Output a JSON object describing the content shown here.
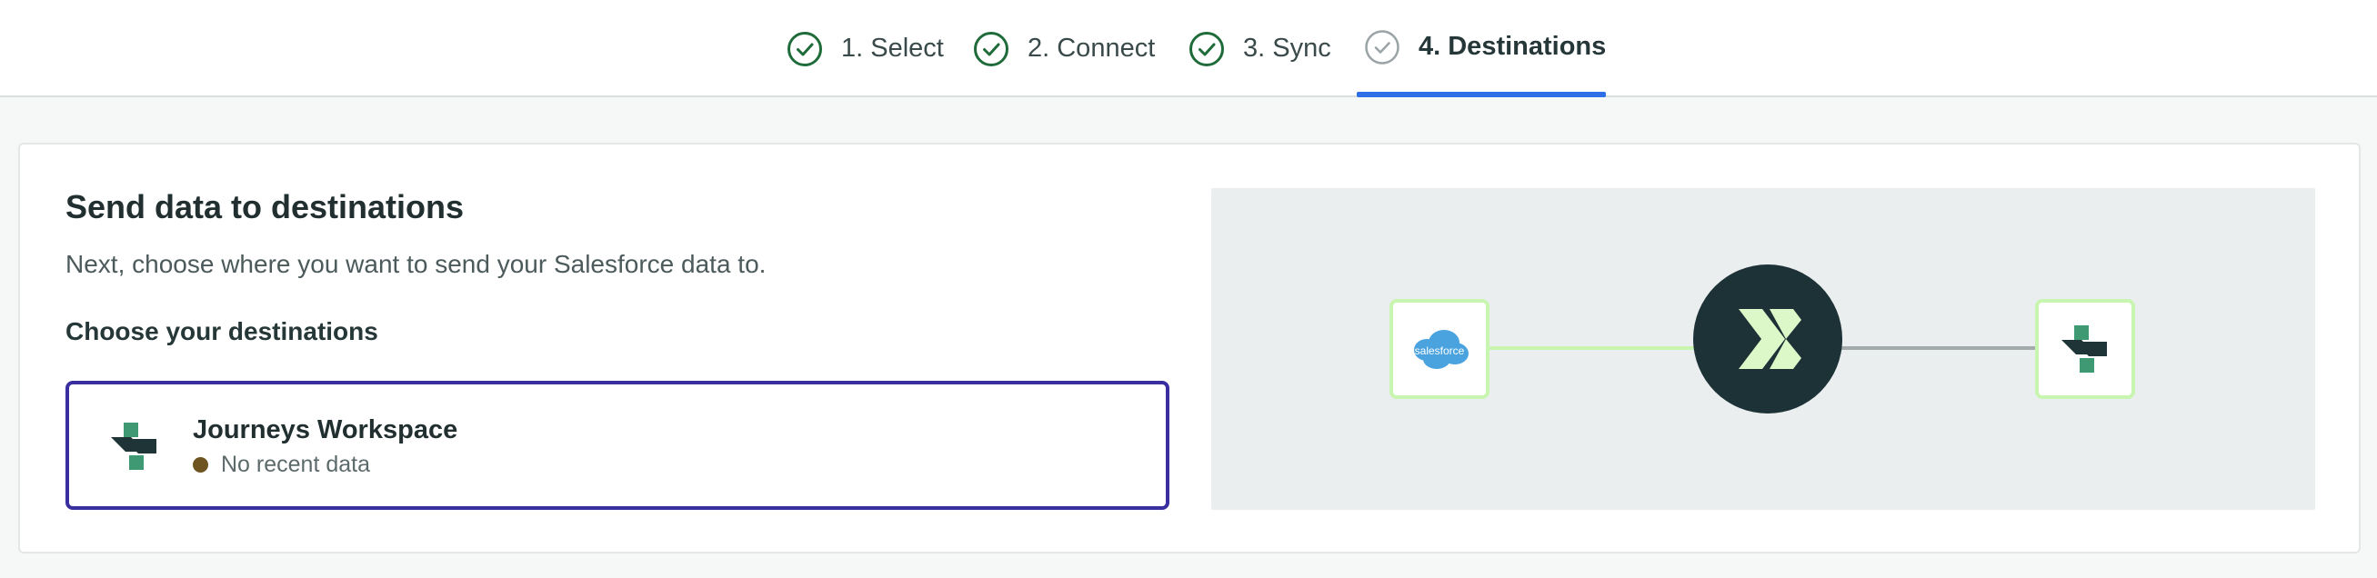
{
  "stepper": {
    "steps": [
      {
        "label": "1. Select",
        "state": "complete"
      },
      {
        "label": "2. Connect",
        "state": "complete"
      },
      {
        "label": "3. Sync",
        "state": "complete"
      },
      {
        "label": "4. Destinations",
        "state": "active"
      }
    ],
    "complete_color": "#1f6b3a",
    "active_underline_color": "#2e6ee6"
  },
  "main": {
    "title": "Send data to destinations",
    "subtitle": "Next, choose where you want to send your Salesforce data to.",
    "destinations_label": "Choose your destinations",
    "destinations": [
      {
        "name": "Journeys Workspace",
        "status": "No recent data",
        "status_color": "#6d5420",
        "selected": true,
        "icon": "workspace-logo-icon"
      }
    ]
  },
  "diagram": {
    "source": {
      "label": "salesforce",
      "icon": "salesforce-logo-icon"
    },
    "hub": {
      "icon": "hub-logo-icon"
    },
    "target": {
      "icon": "workspace-logo-icon"
    },
    "active_link_color": "#c8f5b0",
    "inactive_link_color": "#a3abad"
  }
}
